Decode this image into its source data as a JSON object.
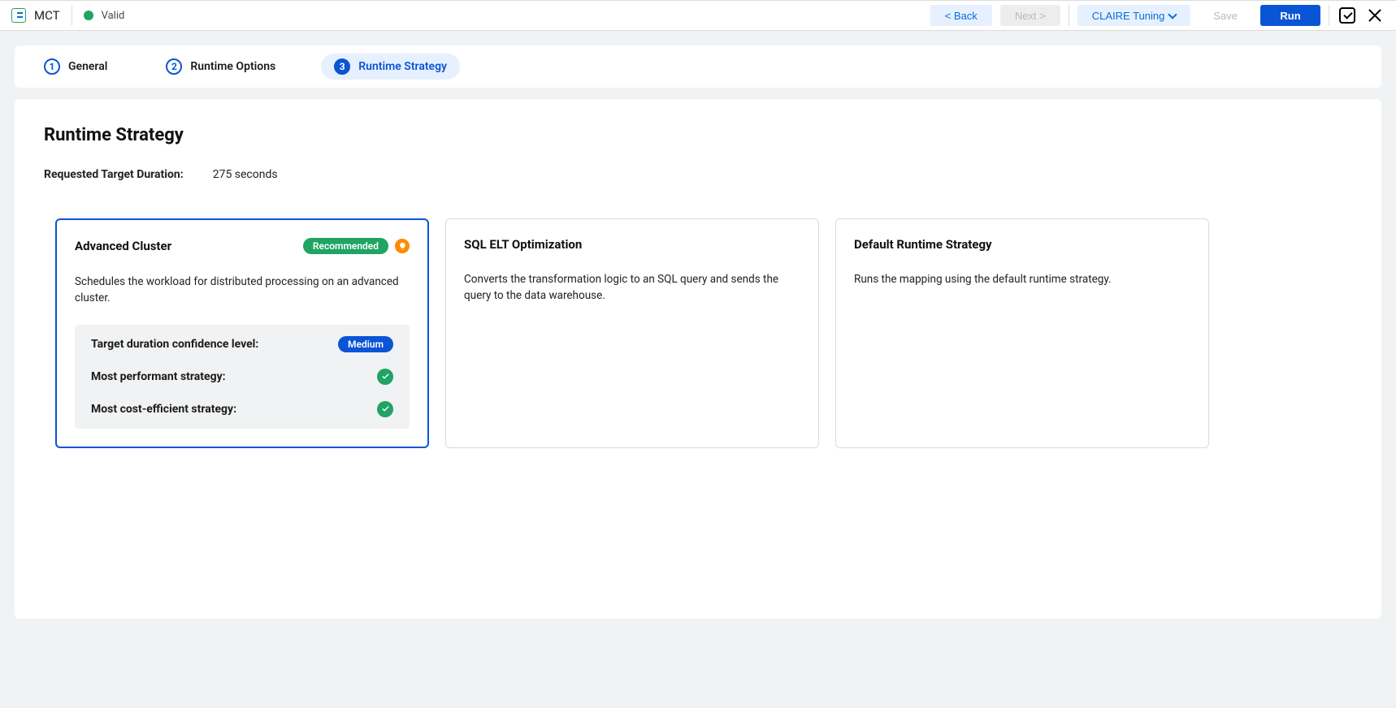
{
  "topbar": {
    "app_title": "MCT",
    "status_text": "Valid",
    "back_label": "< Back",
    "next_label": "Next >",
    "tuning_label": "CLAIRE Tuning",
    "save_label": "Save",
    "run_label": "Run"
  },
  "steps": [
    {
      "num": "1",
      "label": "General"
    },
    {
      "num": "2",
      "label": "Runtime Options"
    },
    {
      "num": "3",
      "label": "Runtime Strategy"
    }
  ],
  "panel": {
    "heading": "Runtime Strategy",
    "duration_label": "Requested Target Duration:",
    "duration_value": "275 seconds"
  },
  "cards": {
    "advanced": {
      "title": "Advanced Cluster",
      "recommended": "Recommended",
      "desc": "Schedules the workload for distributed processing on an advanced cluster.",
      "confidence_label": "Target duration confidence level:",
      "confidence_value": "Medium",
      "perf_label": "Most performant strategy:",
      "cost_label": "Most cost-efficient strategy:"
    },
    "sql": {
      "title": "SQL ELT Optimization",
      "desc": "Converts the transformation logic to an SQL query and sends the query to the data warehouse."
    },
    "default": {
      "title": "Default Runtime Strategy",
      "desc": "Runs the mapping using the default runtime strategy."
    }
  }
}
